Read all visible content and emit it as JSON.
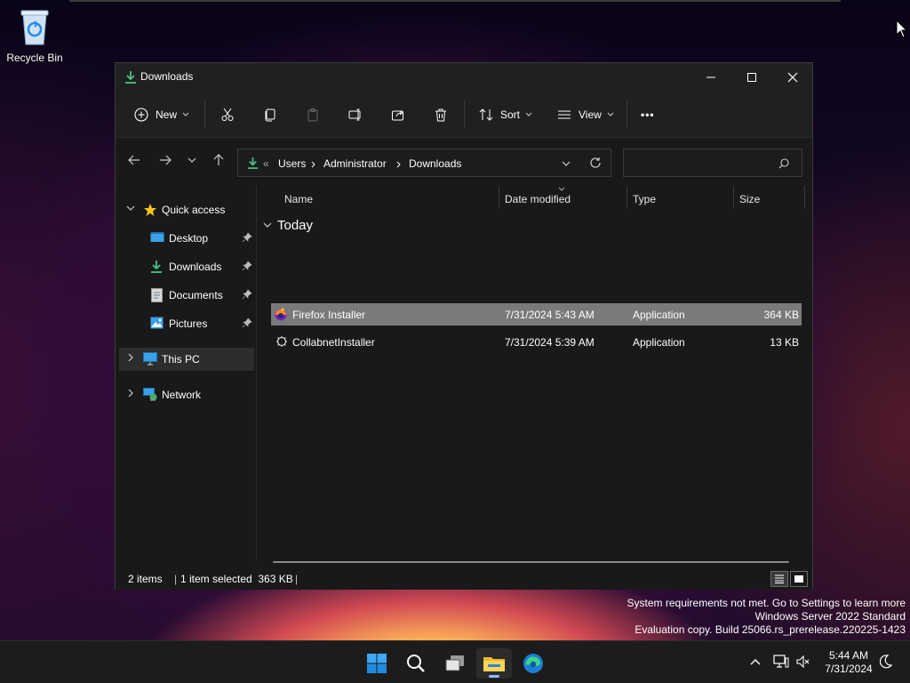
{
  "desktop": {
    "recycle_bin_label": "Recycle Bin"
  },
  "window": {
    "title": "Downloads"
  },
  "toolbar": {
    "new_label": "New",
    "sort_label": "Sort",
    "view_label": "View",
    "more_label": "•••"
  },
  "address": {
    "overflow": "«",
    "segments": [
      "Users",
      "Administrator",
      "Downloads"
    ],
    "search_placeholder": ""
  },
  "sidebar": {
    "quick_access": "Quick access",
    "items": [
      {
        "label": "Desktop",
        "icon": "desktop-icon"
      },
      {
        "label": "Downloads",
        "icon": "downloads-icon"
      },
      {
        "label": "Documents",
        "icon": "documents-icon"
      },
      {
        "label": "Pictures",
        "icon": "pictures-icon"
      }
    ],
    "this_pc": "This PC",
    "network": "Network"
  },
  "columns": {
    "name": "Name",
    "date_modified": "Date modified",
    "type": "Type",
    "size": "Size"
  },
  "group_label": "Today",
  "files": [
    {
      "name": "Firefox Installer",
      "date": "7/31/2024 5:43 AM",
      "type": "Application",
      "size": "364 KB",
      "selected": true
    },
    {
      "name": "CollabnetInstaller",
      "date": "7/31/2024 5:39 AM",
      "type": "Application",
      "size": "13 KB",
      "selected": false
    }
  ],
  "status": {
    "count": "2 items",
    "selection": "1 item selected  363 KB"
  },
  "watermark": {
    "line1": "System requirements not met. Go to Settings to learn more",
    "line2": "Windows Server 2022 Standard",
    "line3": "Evaluation copy. Build 25066.rs_prerelease.220225-1423"
  },
  "clock": {
    "time": "5:44 AM",
    "date": "7/31/2024"
  },
  "colors": {
    "accent_download": "#4cc38a",
    "window_bg": "#191919",
    "selection": "#7a7a7a"
  }
}
